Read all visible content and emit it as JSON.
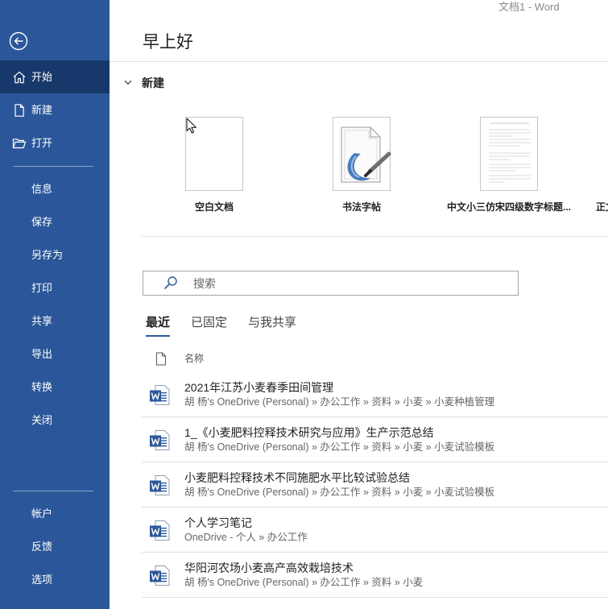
{
  "window": {
    "title": "文档1 - Word"
  },
  "sidebar": {
    "back_icon": "back-arrow-icon",
    "primary": [
      {
        "label": "开始",
        "icon": "home-icon",
        "selected": true
      },
      {
        "label": "新建",
        "icon": "new-document-icon"
      },
      {
        "label": "打开",
        "icon": "open-folder-icon"
      }
    ],
    "middle": [
      {
        "label": "信息"
      },
      {
        "label": "保存"
      },
      {
        "label": "另存为"
      },
      {
        "label": "打印"
      },
      {
        "label": "共享"
      },
      {
        "label": "导出"
      },
      {
        "label": "转换"
      },
      {
        "label": "关闭"
      }
    ],
    "bottom": [
      {
        "label": "帐户"
      },
      {
        "label": "反馈"
      },
      {
        "label": "选项"
      }
    ]
  },
  "greeting": "早上好",
  "new_section": {
    "heading": "新建",
    "templates": [
      {
        "label": "空白文档"
      },
      {
        "label": "书法字帖"
      },
      {
        "label": "中文小三仿宋四级数字标题..."
      },
      {
        "label": "正文"
      }
    ]
  },
  "search": {
    "placeholder": "搜索",
    "icon": "search-icon"
  },
  "tabs": [
    {
      "label": "最近",
      "active": true
    },
    {
      "label": "已固定"
    },
    {
      "label": "与我共享"
    }
  ],
  "file_list": {
    "column_name": "名称",
    "items": [
      {
        "title": "2021年江苏小麦春季田间管理",
        "path": "胡 杨's OneDrive (Personal) » 办公工作 » 资料 » 小麦 » 小麦种植管理",
        "icon": "word-document-icon"
      },
      {
        "title": "1_《小麦肥料控释技术研究与应用》生产示范总结",
        "path": "胡 杨's OneDrive (Personal) » 办公工作 » 资料 » 小麦 » 小麦试验模板",
        "icon": "word-document-icon"
      },
      {
        "title": "小麦肥料控释技术不同施肥水平比较试验总结",
        "path": "胡 杨's OneDrive (Personal) » 办公工作 » 资料 » 小麦 » 小麦试验模板",
        "icon": "word-document-icon"
      },
      {
        "title": "个人学习笔记",
        "path": "OneDrive - 个人 » 办公工作",
        "icon": "word-document-icon"
      },
      {
        "title": "华阳河农场小麦高产高效栽培技术",
        "path": "胡 杨's OneDrive (Personal) » 办公工作 » 资料 » 小麦",
        "icon": "word-document-icon"
      }
    ]
  },
  "colors": {
    "sidebar": "#2b579a",
    "sidebar_selected": "#17386a",
    "accent": "#2b579a",
    "text": "#222222",
    "muted": "#666666"
  }
}
